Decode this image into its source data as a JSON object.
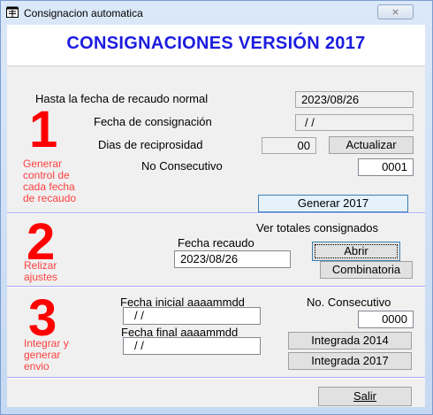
{
  "window": {
    "title": "Consignacion automatica",
    "close_glyph": "⨯"
  },
  "header": {
    "title": "CONSIGNACIONES VERSIÓN 2017"
  },
  "section1": {
    "number": "1",
    "caption": [
      "Generar",
      "control de",
      "cada fecha",
      "de recaudo"
    ],
    "hasta_label": "Hasta la fecha de recaudo normal",
    "hasta_value": "2023/08/26",
    "fecha_consig_label": "Fecha de consignación",
    "fecha_consig_value": "/ /",
    "dias_label": "Dias de reciprosidad",
    "dias_value": "00",
    "actualizar_label": "Actualizar",
    "consecutivo_label": "No Consecutivo",
    "consecutivo_value": "0001",
    "generar_label": "Generar  2017"
  },
  "section2": {
    "number": "2",
    "caption": [
      "Relizar",
      "ajustes"
    ],
    "ver_totales_label": "Ver totales consignados",
    "fecha_recaudo_label": "Fecha recaudo",
    "fecha_recaudo_value": "2023/08/26",
    "abrir_label": "Abrir",
    "combinatoria_label": "Combinatoria"
  },
  "section3": {
    "number": "3",
    "caption": [
      "Integrar y",
      "generar",
      "envio"
    ],
    "fecha_inicial_label": "Fecha inicial aaaammdd",
    "fecha_inicial_value": "/ /",
    "fecha_final_label": "Fecha final aaaammdd",
    "fecha_final_value": "/ /",
    "consecutivo_label": "No. Consecutivo",
    "consecutivo_value": "0000",
    "integrada2014_label": "Integrada 2014",
    "integrada2017_label": "Integrada 2017"
  },
  "footer": {
    "salir_label": "Salir"
  },
  "colors": {
    "title_blue": "#1c1ce0",
    "number_red": "#ff0000",
    "caption_red": "#ff4040"
  }
}
